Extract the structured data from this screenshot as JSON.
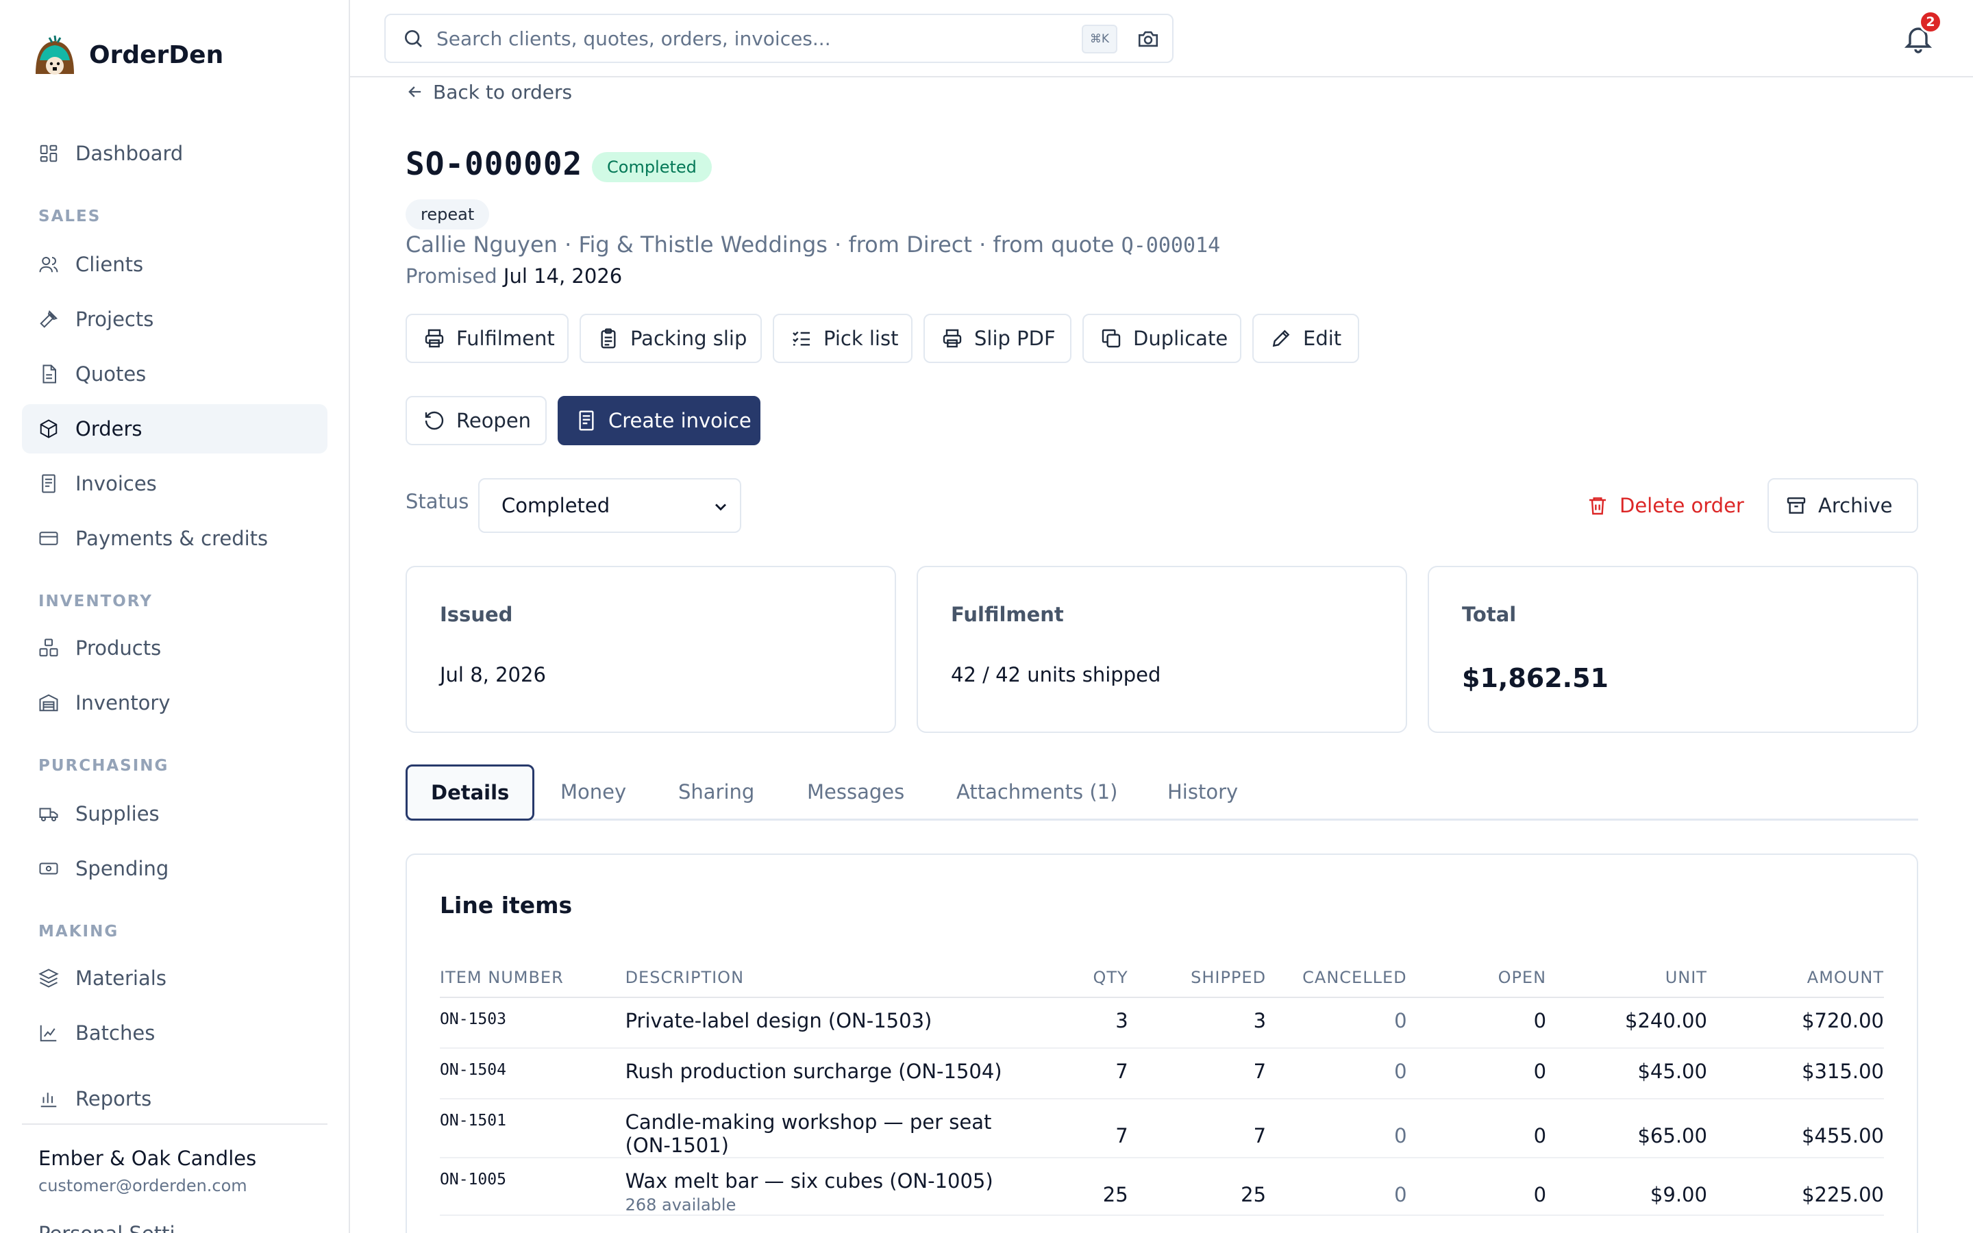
{
  "brand": {
    "name": "OrderDen"
  },
  "search": {
    "placeholder": "Search clients, quotes, orders, invoices...",
    "shortcut": "⌘K"
  },
  "notifications": {
    "count": "2"
  },
  "sidebar": {
    "items": [
      {
        "label": "Dashboard",
        "icon": "dashboard-icon"
      },
      {
        "label": "Clients",
        "icon": "users-icon"
      },
      {
        "label": "Projects",
        "icon": "hammer-icon"
      },
      {
        "label": "Quotes",
        "icon": "document-icon"
      },
      {
        "label": "Orders",
        "icon": "box-icon",
        "active": true
      },
      {
        "label": "Invoices",
        "icon": "receipt-icon"
      },
      {
        "label": "Payments & credits",
        "icon": "credit-card-icon"
      },
      {
        "label": "Products",
        "icon": "products-icon"
      },
      {
        "label": "Inventory",
        "icon": "warehouse-icon"
      },
      {
        "label": "Supplies",
        "icon": "truck-icon"
      },
      {
        "label": "Spending",
        "icon": "banknote-icon"
      },
      {
        "label": "Materials",
        "icon": "layers-icon"
      },
      {
        "label": "Batches",
        "icon": "chart-icon"
      },
      {
        "label": "Reports",
        "icon": "bar-chart-icon"
      }
    ],
    "sections": [
      "SALES",
      "INVENTORY",
      "PURCHASING",
      "MAKING"
    ],
    "account": {
      "name": "Ember & Oak Candles",
      "email": "customer@orderden.com",
      "more": "Personal Setti..."
    }
  },
  "order": {
    "back_label": "Back to orders",
    "number": "SO-000002",
    "status_badge": "Completed",
    "tag": "repeat",
    "client": "Callie Nguyen",
    "company": "Fig & Thistle Weddings",
    "source": "from Direct",
    "quote_prefix": "from quote",
    "quote": "Q-000014",
    "promised_label": "Promised",
    "promised_date": "Jul 14, 2026"
  },
  "actions": {
    "fulfilment": "Fulfilment",
    "packing_slip": "Packing slip",
    "pick_list": "Pick list",
    "slip_pdf": "Slip PDF",
    "duplicate": "Duplicate",
    "edit": "Edit",
    "reopen": "Reopen",
    "create_invoice": "Create invoice",
    "delete_order": "Delete order",
    "archive": "Archive"
  },
  "status": {
    "label": "Status",
    "value": "Completed"
  },
  "cards": {
    "issued": {
      "label": "Issued",
      "value": "Jul 8, 2026"
    },
    "fulfilment": {
      "label": "Fulfilment",
      "value": "42 / 42 units shipped"
    },
    "total": {
      "label": "Total",
      "value": "$1,862.51"
    }
  },
  "tabs": [
    "Details",
    "Money",
    "Sharing",
    "Messages",
    "Attachments (1)",
    "History"
  ],
  "line_items": {
    "title": "Line items",
    "headers": [
      "ITEM NUMBER",
      "DESCRIPTION",
      "QTY",
      "SHIPPED",
      "CANCELLED",
      "OPEN",
      "UNIT",
      "AMOUNT"
    ],
    "rows": [
      {
        "item": "ON-1503",
        "description": "Private-label design (ON-1503)",
        "qty": "3",
        "shipped": "3",
        "cancelled": "0",
        "open": "0",
        "unit": "$240.00",
        "amount": "$720.00"
      },
      {
        "item": "ON-1504",
        "description": "Rush production surcharge (ON-1504)",
        "qty": "7",
        "shipped": "7",
        "cancelled": "0",
        "open": "0",
        "unit": "$45.00",
        "amount": "$315.00"
      },
      {
        "item": "ON-1501",
        "description": "Candle-making workshop — per seat (ON-1501)",
        "qty": "7",
        "shipped": "7",
        "cancelled": "0",
        "open": "0",
        "unit": "$65.00",
        "amount": "$455.00"
      },
      {
        "item": "ON-1005",
        "description": "Wax melt bar — six cubes (ON-1005)",
        "sub": "268 available",
        "qty": "25",
        "shipped": "25",
        "cancelled": "0",
        "open": "0",
        "unit": "$9.00",
        "amount": "$225.00"
      }
    ]
  },
  "colors": {
    "accent": "#27396b",
    "success_bg": "#d1fae5",
    "success_text": "#047857",
    "danger": "#dc2626"
  }
}
